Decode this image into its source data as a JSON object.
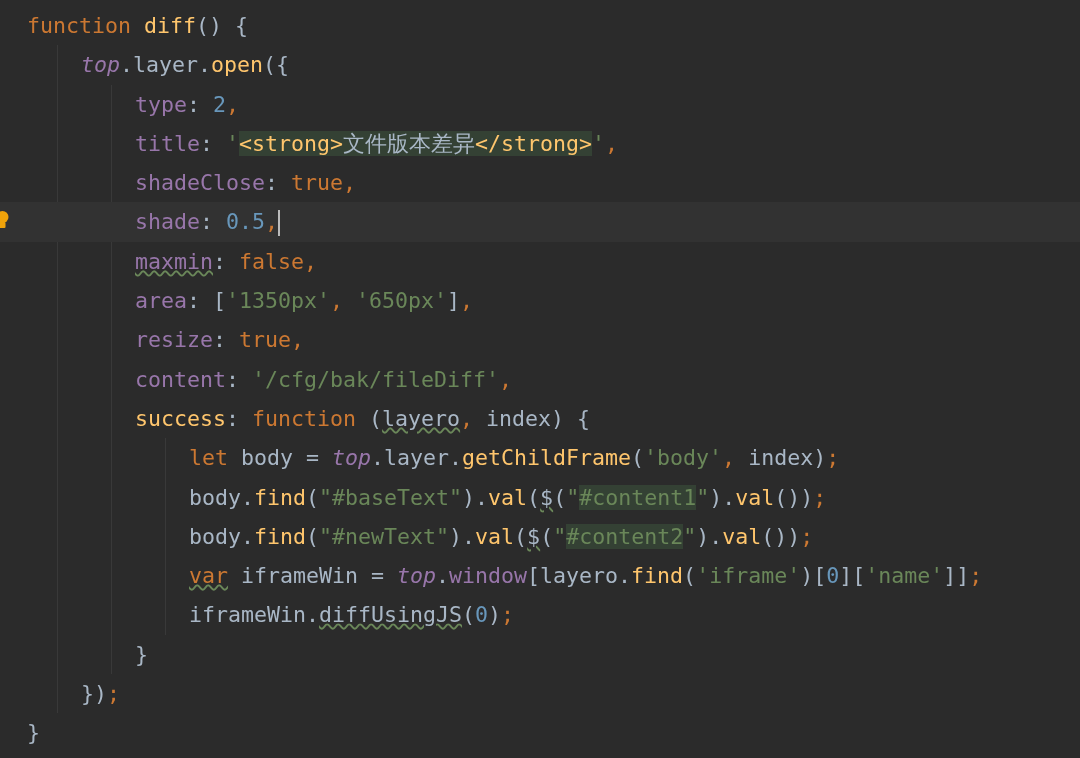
{
  "editor": {
    "lines": [
      {
        "current": false,
        "tokens": [
          {
            "text": "function ",
            "kind": "kw"
          },
          {
            "text": "diff",
            "kind": "fn"
          },
          {
            "text": "() {",
            "kind": "txt"
          }
        ],
        "children": [
          {
            "current": false,
            "tokens": [
              {
                "text": "top",
                "kind": "glob"
              },
              {
                "text": ".layer.",
                "kind": "txt"
              },
              {
                "text": "open",
                "kind": "fn"
              },
              {
                "text": "({",
                "kind": "txt"
              }
            ],
            "children": [
              {
                "current": false,
                "tokens": [
                  {
                    "text": "type",
                    "kind": "prop"
                  },
                  {
                    "text": ": ",
                    "kind": "txt"
                  },
                  {
                    "text": "2",
                    "kind": "num"
                  },
                  {
                    "text": ",",
                    "kind": "punc"
                  }
                ]
              },
              {
                "current": false,
                "tokens": [
                  {
                    "text": "title",
                    "kind": "prop"
                  },
                  {
                    "text": ": ",
                    "kind": "txt"
                  },
                  {
                    "text": "'",
                    "kind": "str"
                  },
                  {
                    "text": "<strong>",
                    "kind": "fn",
                    "highlighted": true
                  },
                  {
                    "text": "文件版本差异",
                    "kind": "txt",
                    "highlighted": true
                  },
                  {
                    "text": "</strong>",
                    "kind": "fn",
                    "highlighted": true
                  },
                  {
                    "text": "'",
                    "kind": "str"
                  },
                  {
                    "text": ",",
                    "kind": "punc"
                  }
                ]
              },
              {
                "current": false,
                "tokens": [
                  {
                    "text": "shadeClose",
                    "kind": "prop"
                  },
                  {
                    "text": ": ",
                    "kind": "txt"
                  },
                  {
                    "text": "true",
                    "kind": "kw"
                  },
                  {
                    "text": ",",
                    "kind": "punc"
                  }
                ]
              },
              {
                "current": true,
                "tokens": [
                  {
                    "text": "shade",
                    "kind": "prop"
                  },
                  {
                    "text": ": ",
                    "kind": "txt"
                  },
                  {
                    "text": "0.5",
                    "kind": "num"
                  },
                  {
                    "text": ",",
                    "kind": "punc"
                  }
                ]
              },
              {
                "current": false,
                "tokens": [
                  {
                    "text": "maxmin",
                    "kind": "prop",
                    "warning": true
                  },
                  {
                    "text": ": ",
                    "kind": "txt"
                  },
                  {
                    "text": "false",
                    "kind": "kw"
                  },
                  {
                    "text": ",",
                    "kind": "punc"
                  }
                ]
              },
              {
                "current": false,
                "tokens": [
                  {
                    "text": "area",
                    "kind": "prop"
                  },
                  {
                    "text": ": [",
                    "kind": "txt"
                  },
                  {
                    "text": "'1350px'",
                    "kind": "str"
                  },
                  {
                    "text": ", ",
                    "kind": "punc"
                  },
                  {
                    "text": "'650px'",
                    "kind": "str"
                  },
                  {
                    "text": "]",
                    "kind": "txt"
                  },
                  {
                    "text": ",",
                    "kind": "punc"
                  }
                ]
              },
              {
                "current": false,
                "tokens": [
                  {
                    "text": "resize",
                    "kind": "prop"
                  },
                  {
                    "text": ": ",
                    "kind": "txt"
                  },
                  {
                    "text": "true",
                    "kind": "kw"
                  },
                  {
                    "text": ",",
                    "kind": "punc"
                  }
                ]
              },
              {
                "current": false,
                "tokens": [
                  {
                    "text": "content",
                    "kind": "prop"
                  },
                  {
                    "text": ": ",
                    "kind": "txt"
                  },
                  {
                    "text": "'/cfg/bak/fileDiff'",
                    "kind": "str"
                  },
                  {
                    "text": ",",
                    "kind": "punc"
                  }
                ]
              },
              {
                "current": false,
                "tokens": [
                  {
                    "text": "success",
                    "kind": "fn"
                  },
                  {
                    "text": ": ",
                    "kind": "txt"
                  },
                  {
                    "text": "function",
                    "kind": "kw"
                  },
                  {
                    "text": " (",
                    "kind": "txt"
                  },
                  {
                    "text": "layero",
                    "kind": "txt",
                    "warning": true
                  },
                  {
                    "text": ", ",
                    "kind": "punc"
                  },
                  {
                    "text": "index) {",
                    "kind": "txt"
                  }
                ],
                "children": [
                  {
                    "current": false,
                    "tokens": [
                      {
                        "text": "let",
                        "kind": "kw"
                      },
                      {
                        "text": " body = ",
                        "kind": "txt"
                      },
                      {
                        "text": "top",
                        "kind": "glob"
                      },
                      {
                        "text": ".layer.",
                        "kind": "txt"
                      },
                      {
                        "text": "getChildFrame",
                        "kind": "fn"
                      },
                      {
                        "text": "(",
                        "kind": "txt"
                      },
                      {
                        "text": "'body'",
                        "kind": "str"
                      },
                      {
                        "text": ", ",
                        "kind": "punc"
                      },
                      {
                        "text": "index)",
                        "kind": "txt"
                      },
                      {
                        "text": ";",
                        "kind": "punc"
                      }
                    ]
                  },
                  {
                    "current": false,
                    "tokens": [
                      {
                        "text": "body.",
                        "kind": "txt"
                      },
                      {
                        "text": "find",
                        "kind": "fn"
                      },
                      {
                        "text": "(",
                        "kind": "txt"
                      },
                      {
                        "text": "\"#baseText\"",
                        "kind": "str"
                      },
                      {
                        "text": ").",
                        "kind": "txt"
                      },
                      {
                        "text": "val",
                        "kind": "fn"
                      },
                      {
                        "text": "(",
                        "kind": "txt"
                      },
                      {
                        "text": "$",
                        "kind": "txt",
                        "warning": true
                      },
                      {
                        "text": "(",
                        "kind": "txt"
                      },
                      {
                        "text": "\"",
                        "kind": "str"
                      },
                      {
                        "text": "#content1",
                        "kind": "str",
                        "highlighted": true
                      },
                      {
                        "text": "\"",
                        "kind": "str"
                      },
                      {
                        "text": ").",
                        "kind": "txt"
                      },
                      {
                        "text": "val",
                        "kind": "fn"
                      },
                      {
                        "text": "())",
                        "kind": "txt"
                      },
                      {
                        "text": ";",
                        "kind": "punc"
                      }
                    ]
                  },
                  {
                    "current": false,
                    "tokens": [
                      {
                        "text": "body.",
                        "kind": "txt"
                      },
                      {
                        "text": "find",
                        "kind": "fn"
                      },
                      {
                        "text": "(",
                        "kind": "txt"
                      },
                      {
                        "text": "\"#newText\"",
                        "kind": "str"
                      },
                      {
                        "text": ").",
                        "kind": "txt"
                      },
                      {
                        "text": "val",
                        "kind": "fn"
                      },
                      {
                        "text": "(",
                        "kind": "txt"
                      },
                      {
                        "text": "$",
                        "kind": "txt",
                        "warning": true
                      },
                      {
                        "text": "(",
                        "kind": "txt"
                      },
                      {
                        "text": "\"",
                        "kind": "str"
                      },
                      {
                        "text": "#content2",
                        "kind": "str",
                        "highlighted": true
                      },
                      {
                        "text": "\"",
                        "kind": "str"
                      },
                      {
                        "text": ").",
                        "kind": "txt"
                      },
                      {
                        "text": "val",
                        "kind": "fn"
                      },
                      {
                        "text": "())",
                        "kind": "txt"
                      },
                      {
                        "text": ";",
                        "kind": "punc"
                      }
                    ]
                  },
                  {
                    "current": false,
                    "tokens": [
                      {
                        "text": "var",
                        "kind": "kw",
                        "warning": true
                      },
                      {
                        "text": " iframeWin = ",
                        "kind": "txt"
                      },
                      {
                        "text": "top",
                        "kind": "glob"
                      },
                      {
                        "text": ".",
                        "kind": "txt"
                      },
                      {
                        "text": "window",
                        "kind": "prop"
                      },
                      {
                        "text": "[layero.",
                        "kind": "txt"
                      },
                      {
                        "text": "find",
                        "kind": "fn"
                      },
                      {
                        "text": "(",
                        "kind": "txt"
                      },
                      {
                        "text": "'iframe'",
                        "kind": "str"
                      },
                      {
                        "text": ")[",
                        "kind": "txt"
                      },
                      {
                        "text": "0",
                        "kind": "num"
                      },
                      {
                        "text": "][",
                        "kind": "txt"
                      },
                      {
                        "text": "'name'",
                        "kind": "str"
                      },
                      {
                        "text": "]]",
                        "kind": "txt"
                      },
                      {
                        "text": ";",
                        "kind": "punc"
                      }
                    ]
                  },
                  {
                    "current": false,
                    "tokens": [
                      {
                        "text": "iframeWin.",
                        "kind": "txt"
                      },
                      {
                        "text": "diffUsingJS",
                        "kind": "txt",
                        "warning": true
                      },
                      {
                        "text": "(",
                        "kind": "txt"
                      },
                      {
                        "text": "0",
                        "kind": "num"
                      },
                      {
                        "text": ")",
                        "kind": "txt"
                      },
                      {
                        "text": ";",
                        "kind": "punc"
                      }
                    ]
                  }
                ]
              },
              {
                "current": false,
                "tokens": [
                  {
                    "text": "}",
                    "kind": "txt"
                  }
                ]
              }
            ]
          },
          {
            "current": false,
            "tokens": [
              {
                "text": "})",
                "kind": "txt"
              },
              {
                "text": ";",
                "kind": "punc"
              }
            ]
          }
        ]
      },
      {
        "current": false,
        "tokens": [
          {
            "text": "}",
            "kind": "txt"
          }
        ]
      }
    ]
  }
}
